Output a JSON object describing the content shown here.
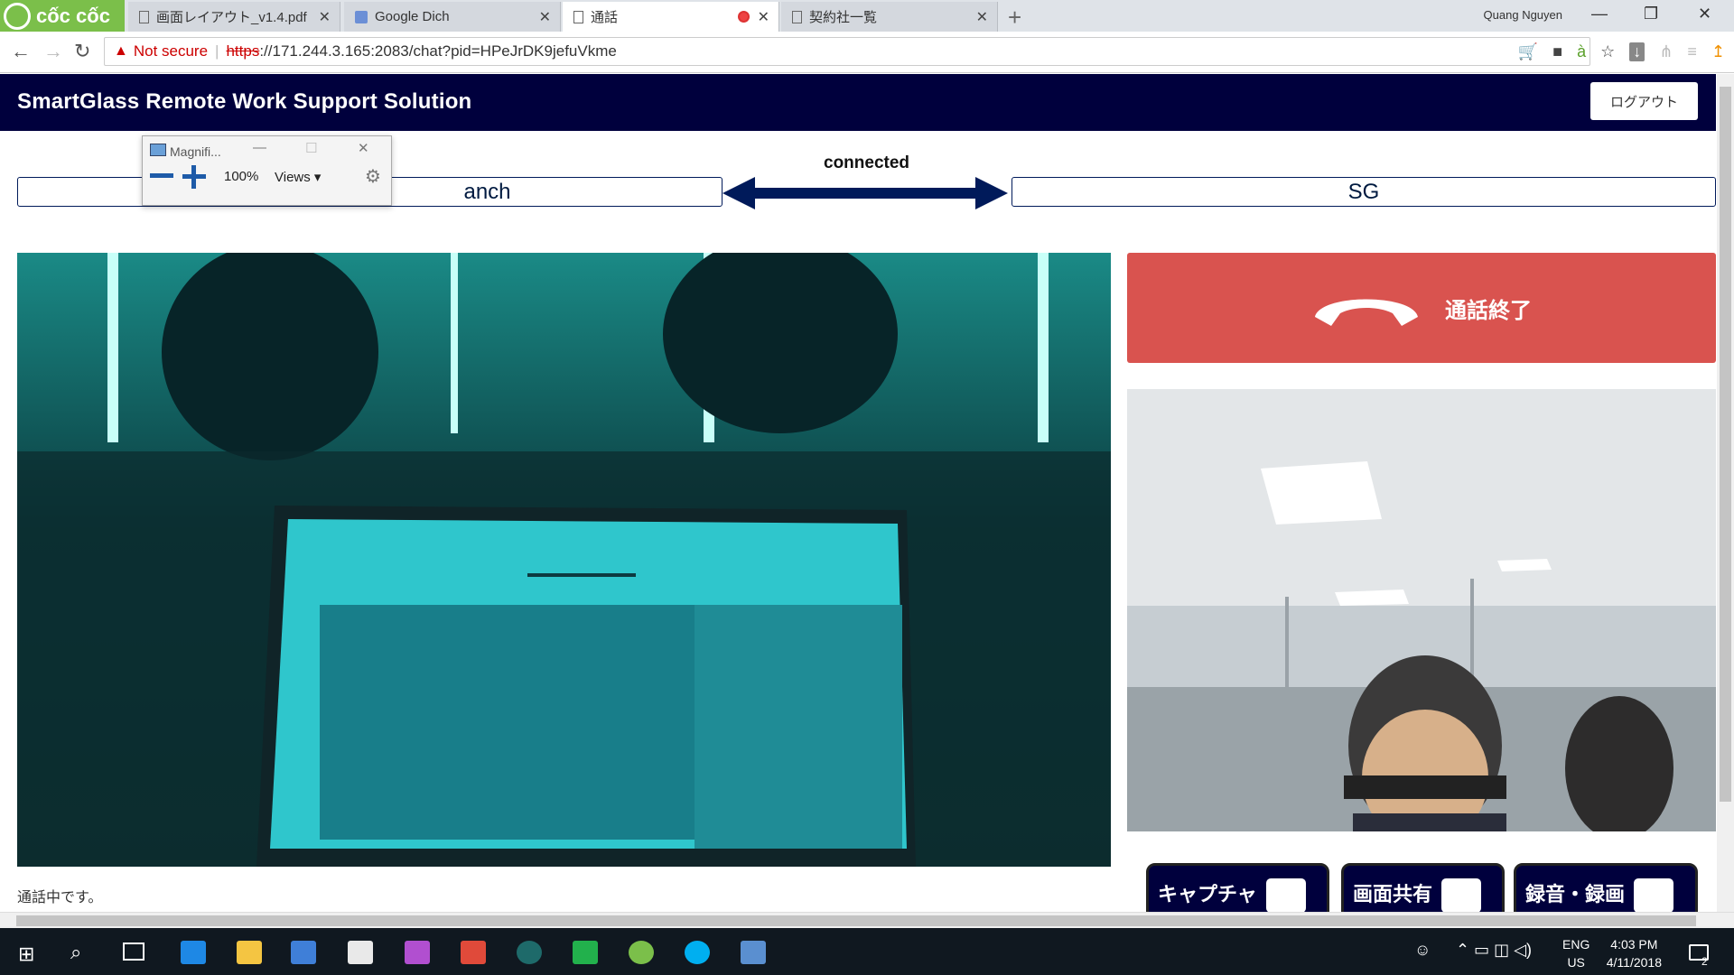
{
  "browser": {
    "brand": "cốc cốc",
    "tabs": [
      {
        "title": "画面レイアウト_v1.4.pdf"
      },
      {
        "title": "Google Dich"
      },
      {
        "title": "通話"
      },
      {
        "title": "契約社一覧"
      }
    ],
    "window_user": "Quang Nguyen",
    "security_label": "Not secure",
    "url_scheme": "https",
    "url_rest": "://171.244.3.165:2083/chat?pid=HPeJrDK9jefuVkme"
  },
  "header": {
    "title": "SmartGlass Remote Work Support Solution",
    "logout_label": "ログアウト"
  },
  "connection": {
    "status": "connected",
    "left_label": "anch",
    "right_label": "SG"
  },
  "call": {
    "end_call_label": "通話終了",
    "status_text": "通話中です。"
  },
  "actions": {
    "capture_label": "キャプチャ",
    "screen_share_label": "画面共有",
    "record_label": "録音・録画"
  },
  "magnifier": {
    "title": "Magnifi...",
    "zoom": "100%",
    "views_label": "Views"
  },
  "taskbar": {
    "time": "4:03 PM",
    "date": "4/11/2018",
    "lang": "ENG",
    "region": "US",
    "notifications": "2"
  },
  "colors": {
    "navbar": "#00003d",
    "end_call": "#d9534f",
    "brand": "#7bbf4a",
    "insecure": "#cc0000"
  }
}
